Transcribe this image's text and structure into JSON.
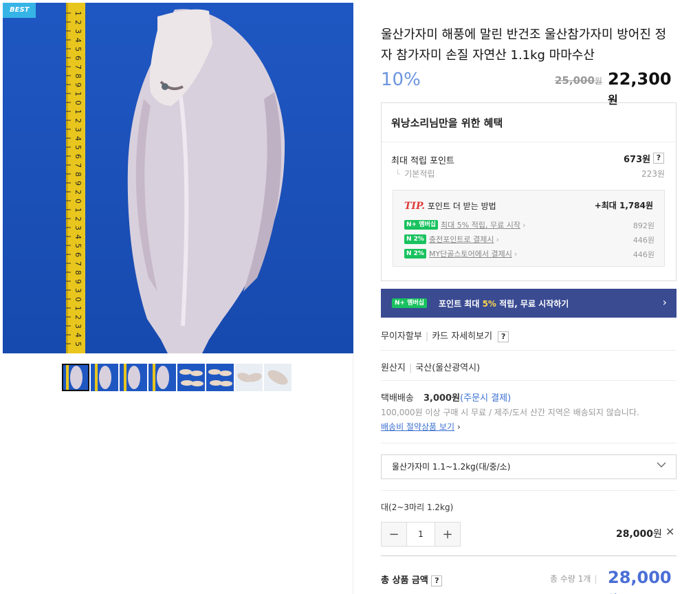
{
  "gallery": {
    "badge": "BEST",
    "thumbnail_count": 8,
    "ruler_digits": "12345678910123456789201234567893012345"
  },
  "product": {
    "title": "울산가자미 해풍에 말린 반건조 울산참가자미 방어진 정자 참가자미 손질 자연산 1.1kg 마마수산",
    "discount": "10%",
    "original_price": "25,000",
    "original_price_unit": "원",
    "sale_price": "22,300",
    "sale_price_unit": "원"
  },
  "benefit": {
    "title": "워낭소리님만을 위한 혜택",
    "max_points_label": "최대 적립 포인트",
    "max_points_value": "673원",
    "question_mark": "?",
    "base_label": "기본적립",
    "base_value": "223원",
    "tip": {
      "tip_word": "TIP.",
      "title": "포인트 더 받는 방법",
      "max": "+최대 1,784원",
      "rows": [
        {
          "badge": "N+ 멤버십",
          "text": "최대 5% 적립, 무료 시작",
          "value": "892원"
        },
        {
          "badge": "N 2%",
          "text": "충전포인트로 결제시",
          "value": "446원"
        },
        {
          "badge": "N 2%",
          "text": "MY단골스토어에서 결제시",
          "value": "446원"
        }
      ]
    }
  },
  "membership_bar": {
    "badge": "N+ 멤버십",
    "text_before": "포인트 최대 ",
    "highlight": "5%",
    "text_after": " 적립, 무료 시작하기",
    "arrow": "›"
  },
  "payment": {
    "installment": "무이자할부",
    "card_details": "카드 자세히보기",
    "question_mark": "?"
  },
  "origin": {
    "label": "원산지",
    "value": "국산(울산광역시)"
  },
  "shipping": {
    "label": "택배배송",
    "fee": "3,000원",
    "fee_note": "(주문시 결제)",
    "notice": "100,000원 이상 구매 시 무료 / 제주/도서 산간 지역은 배송되지 않습니다.",
    "link": "배송비 절약상품 보기",
    "link_arrow": "›"
  },
  "option": {
    "selected": "울산가자미 1.1~1.2kg(대/중/소)"
  },
  "selection": {
    "item_name": "대(2~3마리 1.2kg)",
    "minus": "−",
    "quantity": "1",
    "plus": "+",
    "line_total": "28,000",
    "line_total_unit": "원",
    "remove": "✕"
  },
  "total": {
    "label": "총 상품 금액",
    "question_mark": "?",
    "quantity_text": "총 수량 1개",
    "price": "28,000",
    "price_unit": "원"
  },
  "colors": {
    "discount": "#6c95df",
    "membership_bar": "#3a4b92",
    "total_price": "#4b6ed6",
    "naver_green": "#19c25f",
    "tip_red": "#e03a3a"
  }
}
